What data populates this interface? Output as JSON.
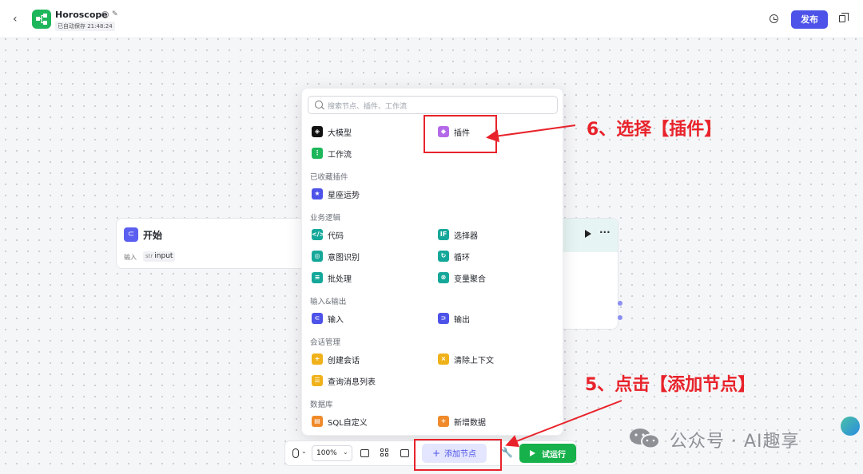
{
  "header": {
    "back_icon": "chevron-left-icon",
    "app_icon": "workflow-icon",
    "app_title": "Horoscope",
    "save_status": "已自动保存 21:48:24",
    "publish_label": "发布",
    "colors": {
      "accent": "#4d53e8",
      "app_icon_bg": "#1db65a"
    }
  },
  "start_node": {
    "title": "开始",
    "input_label": "输入",
    "input_type": "str",
    "input_name": "input"
  },
  "menu": {
    "search_placeholder": "搜索节点、插件、工作流",
    "top_items": [
      {
        "label": "大模型",
        "icon": "llm-icon",
        "color": "#111111"
      },
      {
        "label": "插件",
        "icon": "plugin-icon",
        "color": "#b46ae8"
      },
      {
        "label": "工作流",
        "icon": "workflow-icon",
        "color": "#1db65a"
      }
    ],
    "sections": [
      {
        "title": "已收藏插件",
        "items": [
          {
            "label": "星座运势",
            "icon": "star-icon",
            "color": "#4d53e8"
          }
        ]
      },
      {
        "title": "业务逻辑",
        "items": [
          {
            "label": "代码",
            "icon": "code-icon",
            "color": "#15a89a"
          },
          {
            "label": "选择器",
            "icon": "if-icon",
            "color": "#15a89a"
          },
          {
            "label": "意图识别",
            "icon": "intent-icon",
            "color": "#15a89a"
          },
          {
            "label": "循环",
            "icon": "loop-icon",
            "color": "#15a89a"
          },
          {
            "label": "批处理",
            "icon": "batch-icon",
            "color": "#15a89a"
          },
          {
            "label": "变量聚合",
            "icon": "aggregate-icon",
            "color": "#15a89a"
          }
        ]
      },
      {
        "title": "输入&输出",
        "items": [
          {
            "label": "输入",
            "icon": "input-icon",
            "color": "#4d53e8"
          },
          {
            "label": "输出",
            "icon": "output-icon",
            "color": "#4d53e8"
          }
        ]
      },
      {
        "title": "会话管理",
        "items": [
          {
            "label": "创建会话",
            "icon": "create-chat-icon",
            "color": "#f0b21a"
          },
          {
            "label": "清除上下文",
            "icon": "clear-context-icon",
            "color": "#f0b21a"
          },
          {
            "label": "查询消息列表",
            "icon": "message-list-icon",
            "color": "#f0b21a"
          }
        ]
      },
      {
        "title": "数据库",
        "items": [
          {
            "label": "SQL自定义",
            "icon": "sql-icon",
            "color": "#f08a2a"
          },
          {
            "label": "新增数据",
            "icon": "add-data-icon",
            "color": "#f08a2a"
          }
        ]
      }
    ]
  },
  "toolbar": {
    "zoom": "100%",
    "add_node_label": "添加节点",
    "run_label": "试运行",
    "colors": {
      "run": "#17b14b",
      "add_bg": "#e4e6ff"
    }
  },
  "annotations": {
    "step6": "6、选择【插件】",
    "step5": "5、点击【添加节点】",
    "color": "#e8232b"
  },
  "watermark": {
    "text": "公众号 · AI趣享"
  }
}
